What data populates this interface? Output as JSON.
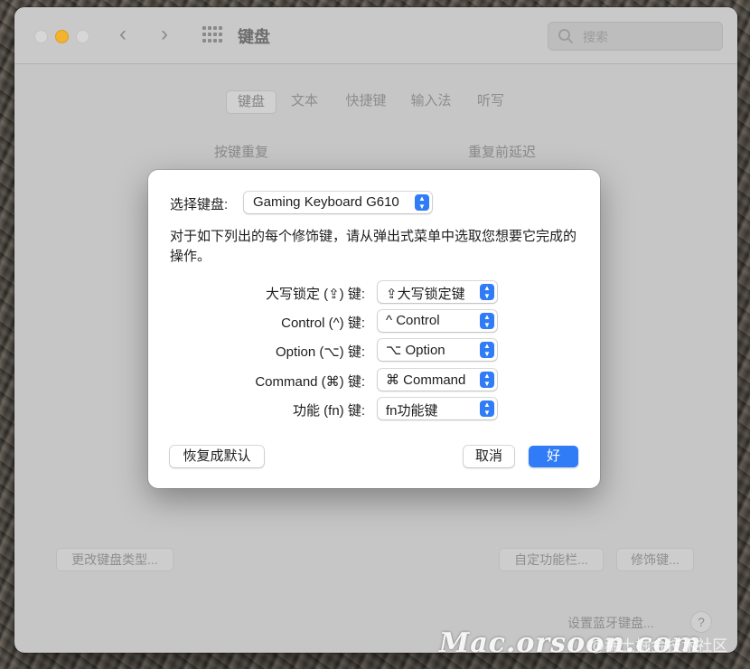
{
  "window": {
    "title": "键盘",
    "search_placeholder": "搜索",
    "tabs": [
      "键盘",
      "文本",
      "快捷键",
      "输入法",
      "听写"
    ],
    "active_tab": "键盘",
    "section_left": "按键重复",
    "section_right": "重复前延迟",
    "change_type_button": "更改键盘类型...",
    "custom_bar_button": "自定功能栏...",
    "modifier_button": "修饰键...",
    "bluetooth_link": "设置蓝牙键盘...",
    "help": "?"
  },
  "dialog": {
    "select_label": "选择键盘:",
    "selected_keyboard": "Gaming Keyboard G610",
    "description": "对于如下列出的每个修饰键，请从弹出式菜单中选取您想要它完成的操作。",
    "rows": [
      {
        "label": "大写锁定 (⇪) 键:",
        "value": "⇪大写锁定键"
      },
      {
        "label": "Control (^) 键:",
        "value": "^ Control"
      },
      {
        "label": "Option (⌥) 键:",
        "value": "⌥ Option"
      },
      {
        "label": "Command (⌘) 键:",
        "value": "⌘ Command"
      },
      {
        "label": "功能 (fn) 键:",
        "value": "fn功能键"
      }
    ],
    "restore_button": "恢复成默认",
    "cancel_button": "取消",
    "ok_button": "好"
  },
  "watermark": {
    "main": "Mac.orsoon.com",
    "sub": "@稀土掘金技术社区"
  }
}
